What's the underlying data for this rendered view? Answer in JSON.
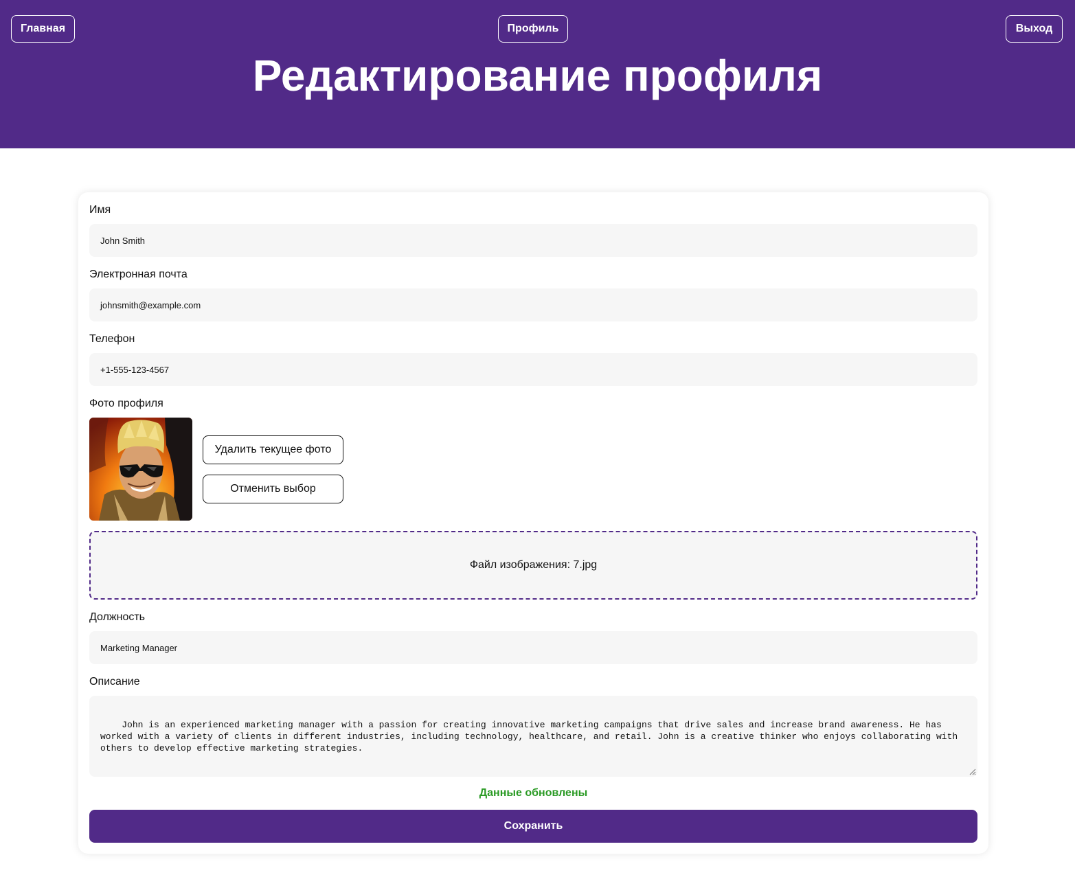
{
  "header": {
    "home_label": "Главная",
    "profile_label": "Профиль",
    "logout_label": "Выход",
    "title": "Редактирование профиля"
  },
  "form": {
    "name": {
      "label": "Имя",
      "value": "John Smith"
    },
    "email": {
      "label": "Электронная почта",
      "value": "johnsmith@example.com"
    },
    "phone": {
      "label": "Телефон",
      "value": "+1-555-123-4567"
    },
    "photo": {
      "label": "Фото профиля",
      "delete_label": "Удалить текущее фото",
      "cancel_label": "Отменить выбор",
      "file_text": "Файл изображения: 7.jpg"
    },
    "position": {
      "label": "Должность",
      "value": "Marketing Manager"
    },
    "description": {
      "label": "Описание",
      "value": "John is an experienced marketing manager with a passion for creating innovative marketing campaigns that drive sales and increase brand awareness. He has worked with a variety of clients in different industries, including technology, healthcare, and retail. John is a creative thinker who enjoys collaborating with others to develop effective marketing strategies."
    },
    "status_text": "Данные обновлены",
    "save_label": "Сохранить"
  },
  "colors": {
    "brand": "#512a88",
    "success": "#2a9a24",
    "field_bg": "#f6f6f6"
  }
}
